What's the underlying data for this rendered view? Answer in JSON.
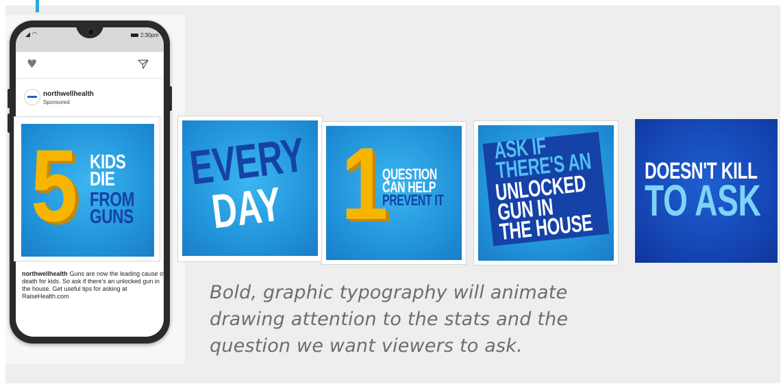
{
  "phone": {
    "status_time": "2:30pm",
    "post": {
      "handle": "northwellhealth",
      "sponsored_label": "Sponsored",
      "caption_handle": "northwellhealth",
      "caption_text": "Guns are now the leading cause of death for kids. So ask if there's an unlocked gun in the house. Get useful tips for asking at RaiseHealth.com"
    }
  },
  "tiles": {
    "five_kids": {
      "number": "5",
      "line_white": "KIDS\nDIE",
      "line_blue": "FROM\nGUNS"
    },
    "every_day": {
      "line_blue": "EVERY",
      "line_white": "DAY"
    },
    "one_question": {
      "number": "1",
      "line_white": "QUESTION\nCAN HELP",
      "line_blue": "PREVENT IT"
    },
    "ask_if": {
      "line_light": "ASK IF\nTHERE'S AN",
      "line_white": "UNLOCKED\nGUN IN\nTHE HOUSE"
    },
    "doesnt_kill": {
      "line_white": "DOESN'T KILL",
      "line_light": "TO ASK"
    }
  },
  "description": "Bold, graphic typography will animate\ndrawing attention to the stats and the\nquestion we want viewers to ask.",
  "colors": {
    "sky_blue": "#1f8fd7",
    "navy": "#1542a6",
    "yellow": "#f7b500",
    "accent": "#29a9df"
  }
}
